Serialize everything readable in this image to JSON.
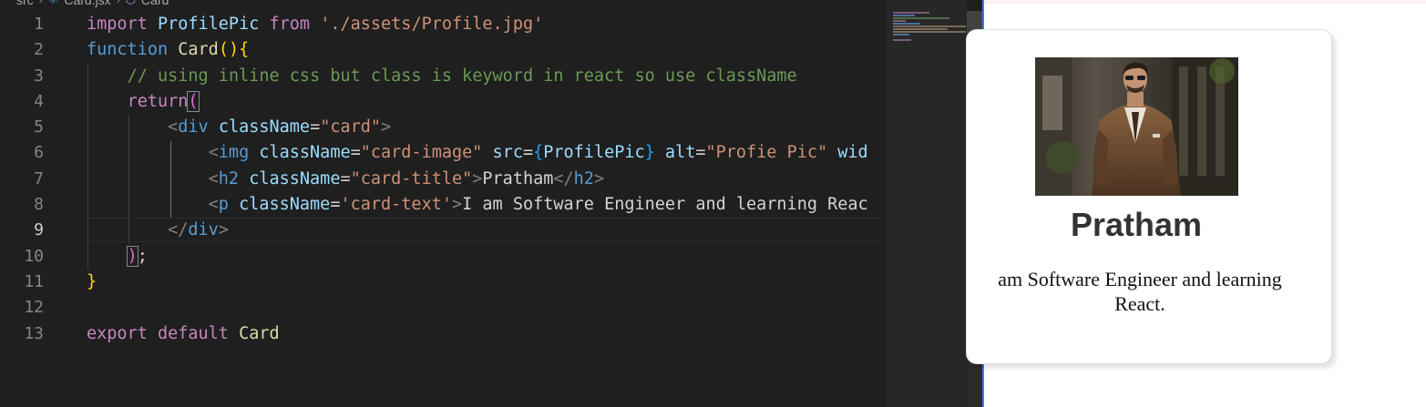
{
  "editor": {
    "breadcrumb": {
      "folder": "src",
      "file": "Card.jsx",
      "symbol": "Card",
      "file_icon": "react-icon",
      "symbol_icon": "component-icon"
    },
    "active_line": 9,
    "line_numbers": [
      "1",
      "2",
      "3",
      "4",
      "5",
      "6",
      "7",
      "8",
      "9",
      "10",
      "11",
      "12",
      "13"
    ],
    "code": {
      "l1": {
        "k": "import",
        "name": "ProfilePic",
        "from": "from",
        "path": "'./assets/Profile.jpg'"
      },
      "l2": {
        "k": "function",
        "name": "Card",
        "open": "(",
        "close": ")",
        "brace": "{"
      },
      "l3": {
        "comment": "// using inline css but class is keyword in react so use className"
      },
      "l4": {
        "k": "return",
        "paren": "("
      },
      "l5": {
        "open": "<",
        "tag": "div",
        "attr": "className",
        "eq": "=",
        "val": "\"card\"",
        "close": ">"
      },
      "l6": {
        "open": "<",
        "tag": "img",
        "attr1": "className",
        "eq": "=",
        "val1": "\"card-image\"",
        "attr2": "src",
        "lb": "{",
        "expr": "ProfilePic",
        "rb": "}",
        "attr3": "alt",
        "val3": "\"Profie Pic\"",
        "attr4": "wid"
      },
      "l7": {
        "open": "<",
        "tag": "h2",
        "attr": "className",
        "eq": "=",
        "val": "\"card-title\"",
        "gt": ">",
        "text": "Pratham",
        "end_open": "</",
        "end_tag": "h2",
        "end_close": ">"
      },
      "l8": {
        "open": "<",
        "tag": "p",
        "attr": "className",
        "eq": "=",
        "val": "'card-text'",
        "gt": ">",
        "text": "I am Software Engineer and learning Reac"
      },
      "l9": {
        "open": "</",
        "tag": "div",
        "close": ">"
      },
      "l10": {
        "paren": ")",
        "semi": ";"
      },
      "l11": {
        "brace": "}"
      },
      "l13": {
        "k1": "export",
        "k2": "default",
        "name": "Card"
      }
    }
  },
  "preview": {
    "card": {
      "title": "Pratham",
      "text": "am Software Engineer and learning React.",
      "image_alt": "Profie Pic"
    }
  },
  "colors": {
    "editor_bg": "#1f1f1f",
    "keyword": "#c586c0",
    "string": "#ce9178",
    "comment": "#6a9955",
    "tag": "#569cd6",
    "attribute": "#9cdcfe",
    "preview_accent": "#3a7be0"
  }
}
